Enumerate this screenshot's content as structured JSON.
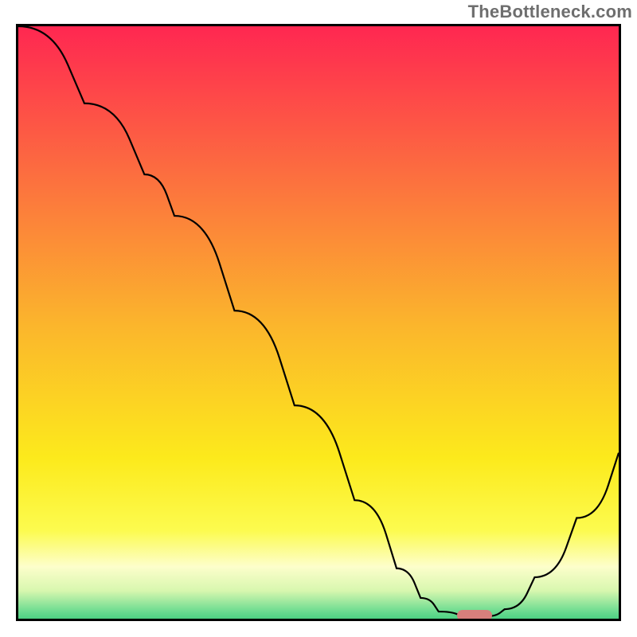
{
  "watermark": "TheBottleneck.com",
  "colors": {
    "gradient_stops": [
      {
        "offset": 0.0,
        "color": "#ff2751"
      },
      {
        "offset": 0.25,
        "color": "#fc6f3f"
      },
      {
        "offset": 0.5,
        "color": "#fbb62c"
      },
      {
        "offset": 0.72,
        "color": "#fcea1c"
      },
      {
        "offset": 0.84,
        "color": "#fcfb4f"
      },
      {
        "offset": 0.9,
        "color": "#fdfecb"
      },
      {
        "offset": 0.94,
        "color": "#d8f7af"
      },
      {
        "offset": 0.975,
        "color": "#6bdb90"
      },
      {
        "offset": 1.0,
        "color": "#2bc775"
      }
    ],
    "curve": "#000000",
    "marker": "#d77f7c",
    "border": "#000000"
  },
  "chart_data": {
    "type": "line",
    "title": "",
    "xlabel": "",
    "ylabel": "",
    "xlim": [
      0,
      100
    ],
    "ylim": [
      0,
      100
    ],
    "note": "x and y are normalized 0–100 across the plotting rectangle; y=0 is the bottom axis, y=100 the top. The curve depicts bottleneck severity (high=red) vs. an unlabeled horizontal parameter; the pink marker sits at the optimum (minimum).",
    "series": [
      {
        "name": "bottleneck-curve",
        "points": [
          {
            "x": 0.0,
            "y": 100.0
          },
          {
            "x": 11.0,
            "y": 87.0
          },
          {
            "x": 21.0,
            "y": 75.0
          },
          {
            "x": 26.0,
            "y": 68.0
          },
          {
            "x": 36.0,
            "y": 52.0
          },
          {
            "x": 46.0,
            "y": 36.0
          },
          {
            "x": 56.0,
            "y": 20.0
          },
          {
            "x": 63.0,
            "y": 8.5
          },
          {
            "x": 67.0,
            "y": 3.5
          },
          {
            "x": 70.0,
            "y": 1.2
          },
          {
            "x": 74.0,
            "y": 0.4
          },
          {
            "x": 78.0,
            "y": 0.4
          },
          {
            "x": 81.0,
            "y": 1.6
          },
          {
            "x": 86.0,
            "y": 7.0
          },
          {
            "x": 93.0,
            "y": 17.0
          },
          {
            "x": 100.0,
            "y": 28.0
          }
        ]
      }
    ],
    "optimum_marker": {
      "x": 76.0,
      "y": 0.6
    }
  }
}
